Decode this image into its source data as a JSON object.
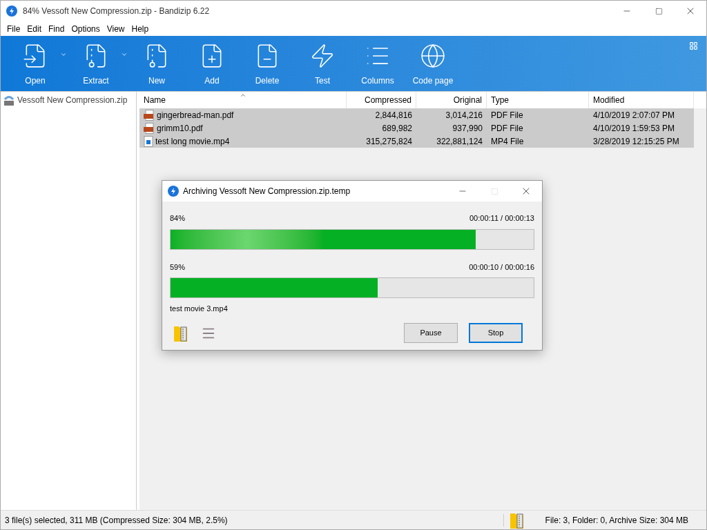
{
  "window": {
    "title": "84% Vessoft New Compression.zip - Bandizip 6.22"
  },
  "menu": [
    "File",
    "Edit",
    "Find",
    "Options",
    "View",
    "Help"
  ],
  "toolbar": [
    {
      "kind": "open",
      "label": "Open",
      "dropdown": true
    },
    {
      "kind": "extract",
      "label": "Extract",
      "dropdown": true
    },
    {
      "kind": "new",
      "label": "New",
      "dropdown": false
    },
    {
      "kind": "add",
      "label": "Add",
      "dropdown": false
    },
    {
      "kind": "delete",
      "label": "Delete",
      "dropdown": false
    },
    {
      "kind": "test",
      "label": "Test",
      "dropdown": false
    },
    {
      "kind": "columns",
      "label": "Columns",
      "dropdown": false
    },
    {
      "kind": "codepage",
      "label": "Code page",
      "dropdown": false
    }
  ],
  "tree": {
    "items": [
      {
        "label": "Vessoft New Compression.zip",
        "selected": false
      }
    ]
  },
  "table": {
    "columns": [
      {
        "label": "Name"
      },
      {
        "label": "Compressed"
      },
      {
        "label": "Original"
      },
      {
        "label": "Type"
      },
      {
        "label": "Modified"
      }
    ],
    "rows": [
      {
        "kind": "pdf",
        "selected": true,
        "cells": [
          "gingerbread-man.pdf",
          "2,844,816",
          "3,014,216",
          "PDF File",
          "4/10/2019 2:07:07 PM"
        ]
      },
      {
        "kind": "pdf",
        "selected": true,
        "cells": [
          "grimm10.pdf",
          "689,982",
          "937,990",
          "PDF File",
          "4/10/2019 1:59:53 PM"
        ]
      },
      {
        "kind": "video",
        "selected": true,
        "cells": [
          "test long movie.mp4",
          "315,275,824",
          "322,881,124",
          "MP4 File",
          "3/28/2019 12:15:25 PM"
        ]
      }
    ]
  },
  "dialog": {
    "title": "Archiving Vessoft New Compression.zip.temp",
    "progress": [
      {
        "percent": "84%",
        "time": "00:00:11 / 00:00:13",
        "level": 0.84
      },
      {
        "percent": "59%",
        "time": "00:00:10 / 00:00:16",
        "level": 0.57
      }
    ],
    "current_file": "test movie 3.mp4",
    "buttons": [
      {
        "label": "Pause",
        "focused": false
      },
      {
        "label": "Stop",
        "focused": true
      }
    ]
  },
  "status_bar": {
    "left": "3 file(s) selected, 311 MB (Compressed Size: 304 MB, 2.5%)",
    "right": "File: 3, Folder: 0, Archive Size: 304 MB"
  }
}
